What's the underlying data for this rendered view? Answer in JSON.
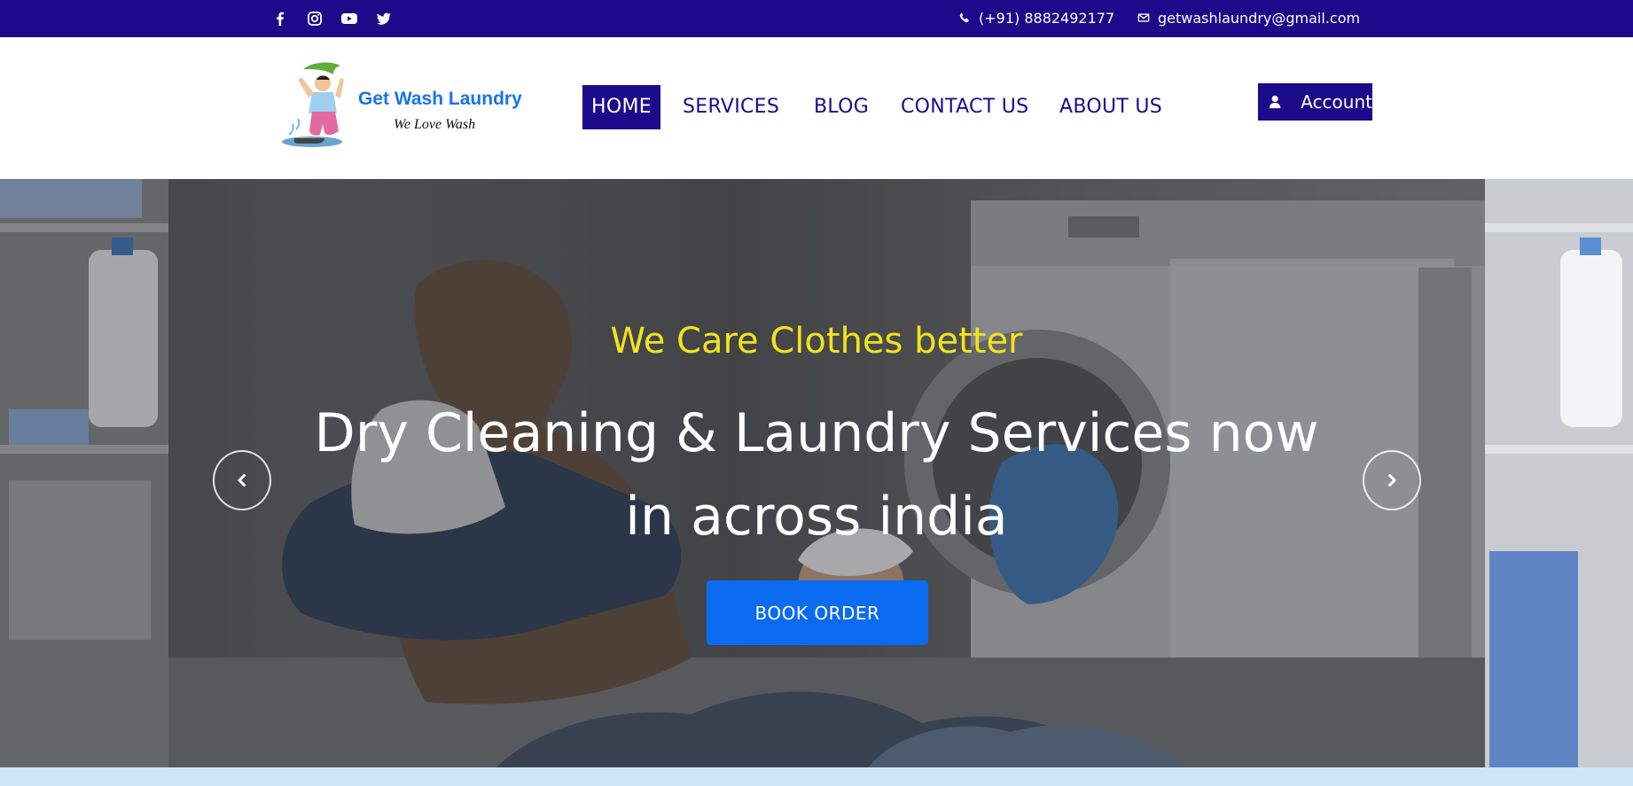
{
  "topbar": {
    "social_icons": [
      "facebook-icon",
      "instagram-icon",
      "youtube-icon",
      "twitter-icon"
    ],
    "phone": "(+91) 8882492177",
    "email": "getwashlaundry@gmail.com",
    "background": "#1b0a8a"
  },
  "header": {
    "logo_title": "Get Wash Laundry",
    "logo_tagline": "We Love Wash",
    "nav": [
      {
        "label": "HOME",
        "active": true
      },
      {
        "label": "SERVICES",
        "active": false
      },
      {
        "label": "BLOG",
        "active": false
      },
      {
        "label": "CONTACT US",
        "active": false
      },
      {
        "label": "ABOUT US",
        "active": false
      }
    ],
    "account_label": "Account",
    "account_icon": "user-icon"
  },
  "hero": {
    "tagline": "We Care Clothes better",
    "title": "Dry Cleaning & Laundry Services now in across india",
    "cta_label": "BOOK ORDER",
    "prev_icon": "chevron-left-icon",
    "next_icon": "chevron-right-icon",
    "tagline_color": "#f2e31c",
    "cta_color": "#0b6bf0"
  }
}
